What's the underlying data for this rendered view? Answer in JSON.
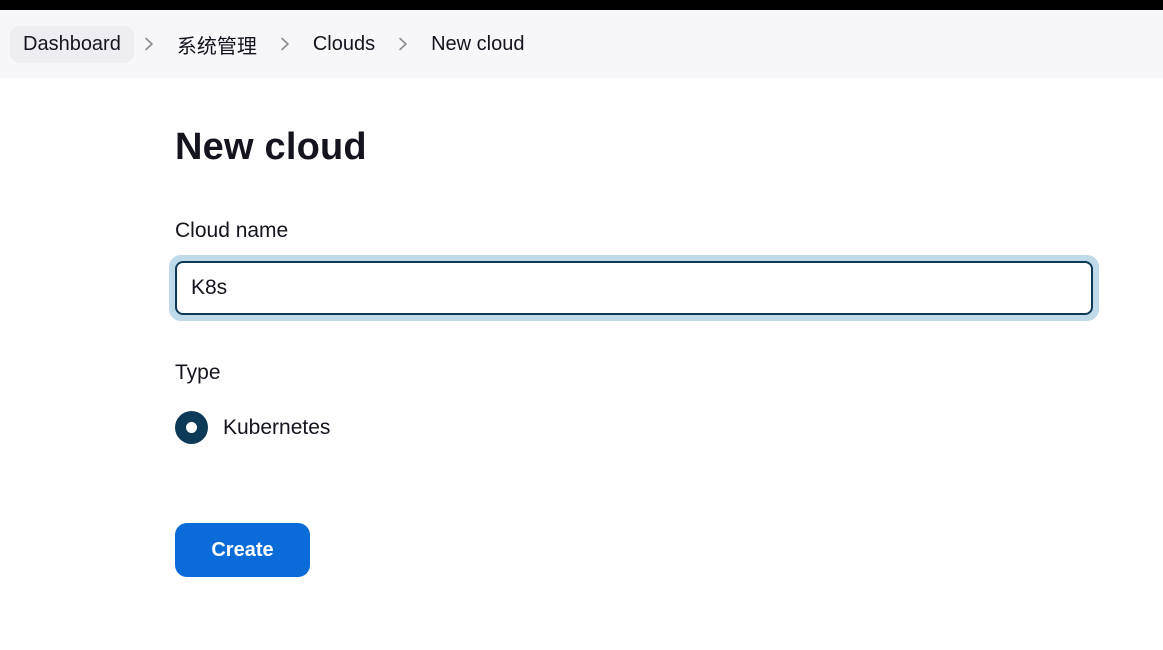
{
  "breadcrumb": {
    "items": [
      {
        "label": "Dashboard"
      },
      {
        "label": "系统管理"
      },
      {
        "label": "Clouds"
      },
      {
        "label": "New cloud"
      }
    ]
  },
  "page": {
    "title": "New cloud"
  },
  "form": {
    "cloud_name_label": "Cloud name",
    "cloud_name_value": "K8s",
    "type_label": "Type",
    "type_options": [
      {
        "label": "Kubernetes",
        "selected": true
      }
    ],
    "submit_label": "Create"
  },
  "colors": {
    "accent": "#0b6bd9",
    "radio": "#0d3a56",
    "input_border": "#0d3a56",
    "focus_ring": "#bfdbe9",
    "breadcrumb_bg": "#f7f7f9"
  },
  "icons": {
    "separator": "chevron-right-icon"
  }
}
